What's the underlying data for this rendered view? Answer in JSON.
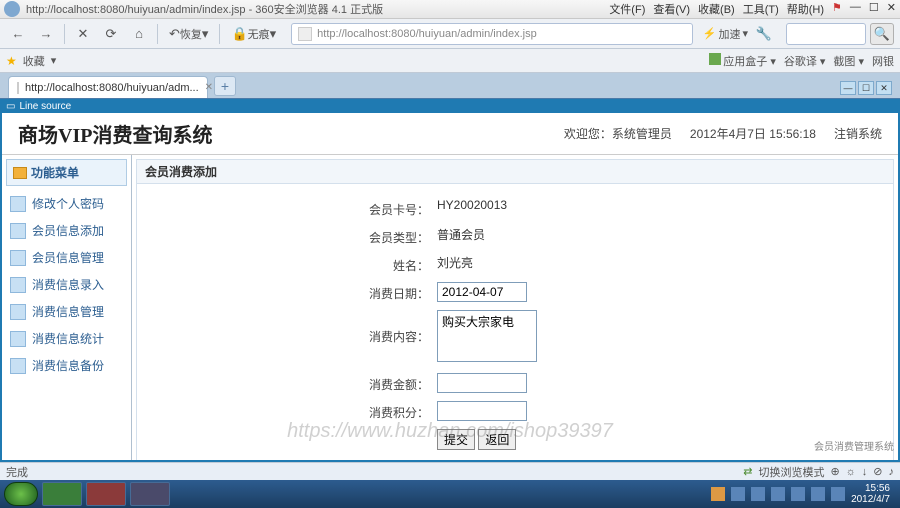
{
  "browser": {
    "window_title": "http://localhost:8080/huiyuan/admin/index.jsp - 360安全浏览器 4.1 正式版",
    "menu": [
      "文件(F)",
      "查看(V)",
      "收藏(B)",
      "工具(T)",
      "帮助(H)"
    ],
    "toolbar": {
      "back": "←",
      "fwd": "→",
      "stop": "✕",
      "reload": "⟳",
      "home": "⌂",
      "restore_label": "恢复",
      "wuhen_label": "无痕",
      "accel_label": "加速"
    },
    "address_url": "http://localhost:8080/huiyuan/admin/index.jsp",
    "favorites_label": "收藏",
    "fav_right": [
      "应用盒子",
      "谷歌译",
      "截图",
      "网银"
    ],
    "tab_title": "http://localhost:8080/huiyuan/adm..."
  },
  "page": {
    "strip_title": "Line source",
    "system_title": "商场VIP消费查询系统",
    "welcome_prefix": "欢迎您：",
    "welcome_user": "系统管理员",
    "datetime": "2012年4月7日  15:56:18",
    "logout": "注销系统",
    "footer_text": "会员消费管理系统"
  },
  "sidebar": {
    "header": "功能菜单",
    "items": [
      "修改个人密码",
      "会员信息添加",
      "会员信息管理",
      "消费信息录入",
      "消费信息管理",
      "消费信息统计",
      "消费信息备份"
    ]
  },
  "panel": {
    "title": "会员消费添加",
    "form": {
      "card_label": "会员卡号：",
      "card_value": "HY20020013",
      "type_label": "会员类型：",
      "type_value": "普通会员",
      "name_label": "姓名：",
      "name_value": "刘光亮",
      "date_label": "消费日期：",
      "date_value": "2012-04-07",
      "content_label": "消费内容：",
      "content_value": "购买大宗家电",
      "amount_label": "消费金额：",
      "amount_value": "",
      "points_label": "消费积分：",
      "points_value": ""
    },
    "submit": "提交",
    "back": "返回"
  },
  "status": {
    "done": "完成",
    "switch_mode": "切换浏览模式"
  },
  "taskbar": {
    "time": "15:56",
    "date": "2012/4/7"
  },
  "watermark": "https://www.huzhan.com/ishop39397"
}
